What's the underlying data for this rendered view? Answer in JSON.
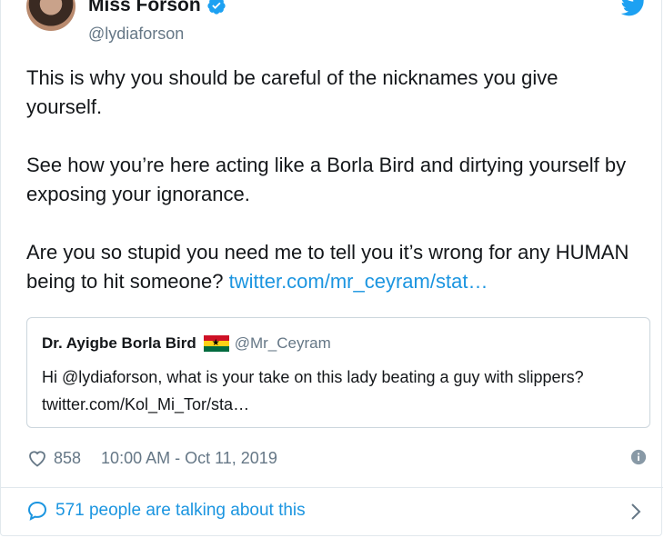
{
  "author": {
    "display_name": "Miss Forson",
    "handle": "@lydiaforson"
  },
  "tweet": {
    "text": "This is why you should be careful of the nicknames you give yourself.\n\nSee how you’re here acting like a Borla Bird and dirtying yourself by exposing your ignorance.\n\nAre you so stupid you need me to tell you it’s wrong for any HUMAN being to hit someone? ",
    "link": "twitter.com/mr_ceyram/stat…"
  },
  "quoted_tweet": {
    "display_name": "Dr. Ayigbe Borla Bird",
    "handle": "@Mr_Ceyram",
    "text": "Hi @lydiaforson, what is your take on this lady beating a guy with slippers? twitter.com/Kol_Mi_Tor/sta…"
  },
  "meta": {
    "likes": "858",
    "timestamp": "10:00 AM - Oct 11, 2019"
  },
  "footer": {
    "talking_label": "571 people are talking about this"
  },
  "icons": [
    "verified-badge-icon",
    "twitter-bird-icon",
    "ghana-flag-icon",
    "heart-icon",
    "info-icon",
    "speech-bubble-icon",
    "chevron-right-icon"
  ],
  "colors": {
    "link": "#1b95e0",
    "verified": "#1da1f2",
    "secondary_text": "#657786",
    "border": "#e1e8ed"
  }
}
